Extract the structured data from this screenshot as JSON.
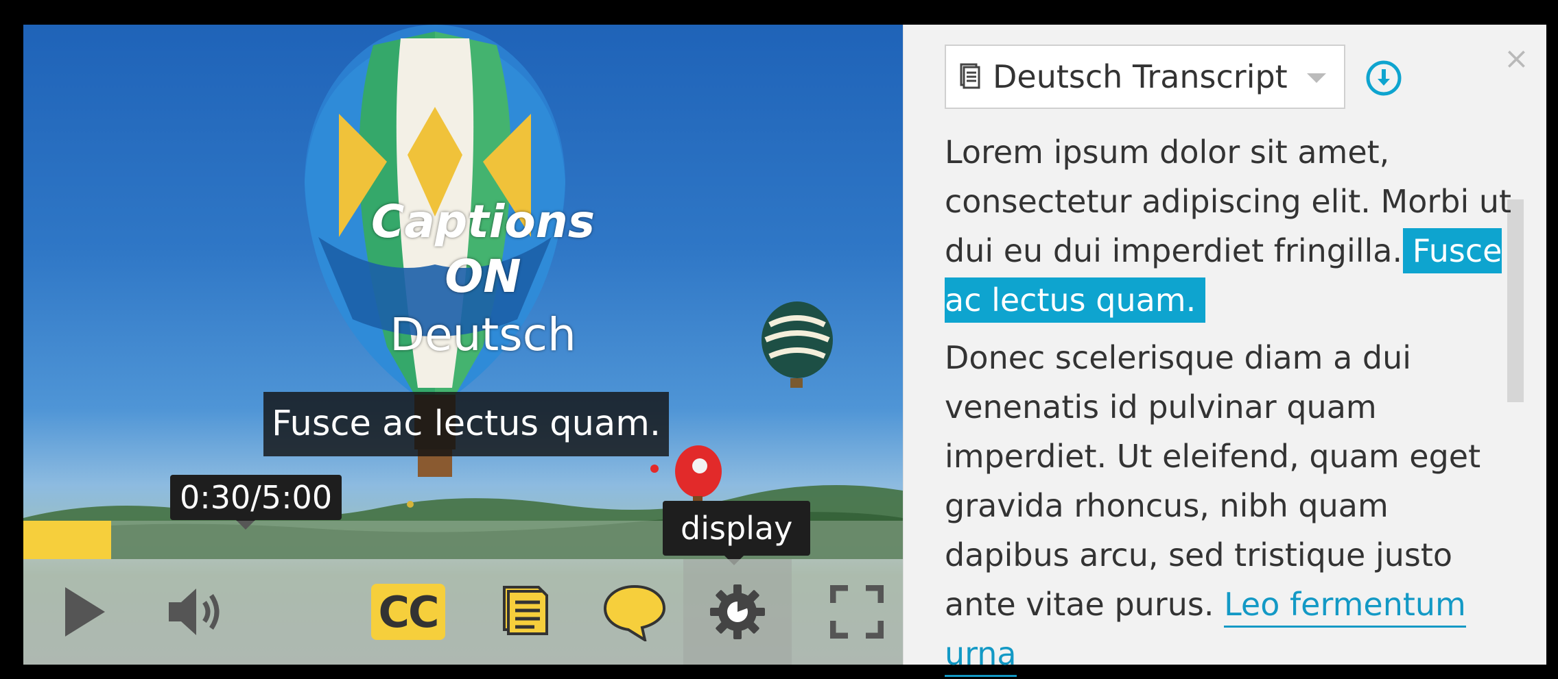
{
  "video": {
    "overlay_title_line1": "Captions ON",
    "overlay_title_line2": "Deutsch",
    "caption_text": "Fusce ac lectus quam.",
    "time_display": "0:30/5:00",
    "progress_fraction": 0.1
  },
  "controls": {
    "play_icon": "play-icon",
    "volume_icon": "volume-icon",
    "cc_label": "CC",
    "transcript_icon": "transcript-icon",
    "description_icon": "speech-bubble-icon",
    "settings_icon": "gear-icon",
    "settings_tooltip": "display",
    "fullscreen_icon": "fullscreen-icon",
    "accent_color": "#f6cf3c"
  },
  "transcript": {
    "language_select": "Deutsch Transcript",
    "download_icon": "download-icon",
    "close_label": "×",
    "paragraph1_plain": "Lorem ipsum dolor sit amet, consectetur adipiscing elit. Morbi ut dui eu dui imperdiet fringilla.",
    "paragraph1_highlight": "Fusce ac lectus quam.",
    "paragraph2_plain": "Donec scelerisque diam a dui venenatis id pulvinar quam imperdiet. Ut eleifend, quam eget gravida rhoncus, nibh quam dapibus arcu, sed tristique justo ante vitae purus.",
    "paragraph2_link": "Leo fermentum urna",
    "highlight_color": "#0ea4cf"
  }
}
